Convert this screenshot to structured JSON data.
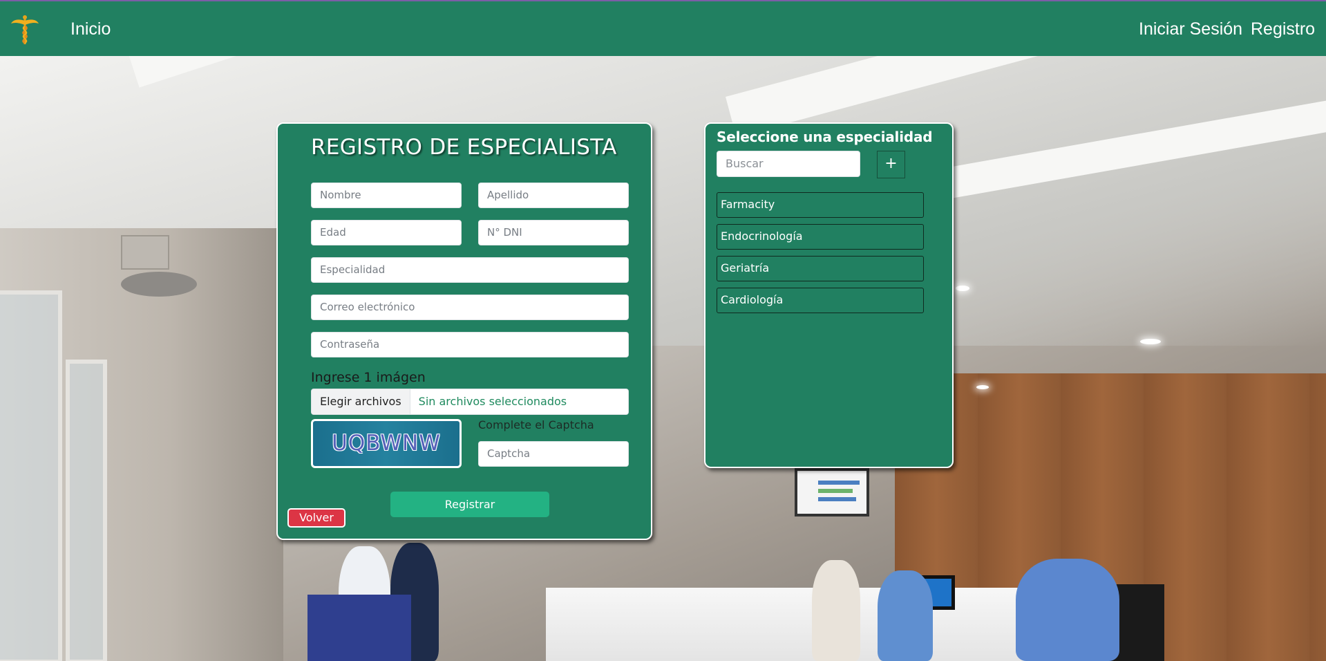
{
  "navbar": {
    "home": "Inicio",
    "login": "Iniciar Sesión",
    "register": "Registro",
    "logo_icon": "caduceus-icon",
    "color": "#218061"
  },
  "register_form": {
    "title": "REGISTRO DE ESPECIALISTA",
    "fields": {
      "name": "Nombre",
      "surname": "Apellido",
      "age": "Edad",
      "dni": "N° DNI",
      "specialty": "Especialidad",
      "email": "Correo electrónico",
      "password": "Contraseña",
      "captcha": "Captcha"
    },
    "image_label": "Ingrese 1 imágen",
    "file_button": "Elegir archivos",
    "file_status": "Sin archivos seleccionados",
    "captcha_code": "UQBWNW",
    "captcha_label": "Complete el Captcha",
    "submit": "Registrar",
    "back": "Volver"
  },
  "specialty_panel": {
    "title": "Seleccione una especialidad",
    "search_placeholder": "Buscar",
    "add_label": "+",
    "items": [
      "Farmacity",
      "Endocrinología",
      "Geriatría",
      "Cardiología"
    ]
  },
  "colors": {
    "primary": "#218061",
    "button": "#23b283",
    "danger": "#dc3545"
  }
}
